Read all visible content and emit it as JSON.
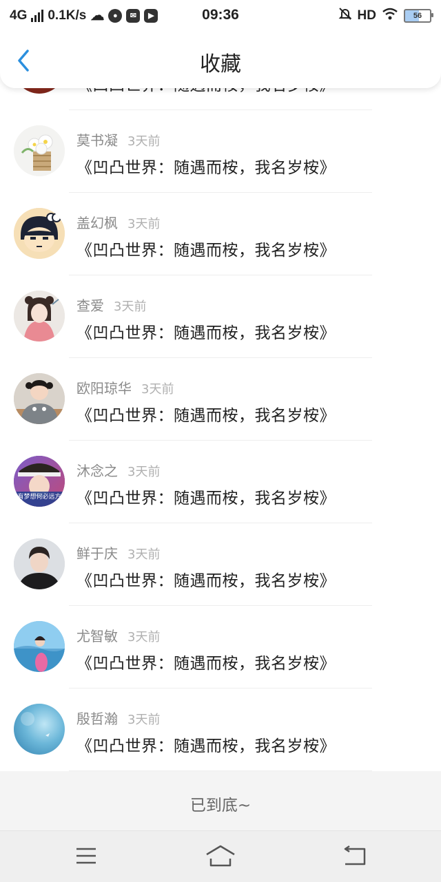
{
  "status_bar": {
    "network": "4G",
    "speed": "0.1K/s",
    "time": "09:36",
    "hd": "HD",
    "battery": "56",
    "notif_icon": "jovi-icon"
  },
  "header": {
    "title": "收藏",
    "back_icon": "back-chevron-icon",
    "accent": "#2b8fde"
  },
  "items": [
    {
      "name": "",
      "time": "",
      "content": "《凹凸世界：随遇而桉，我名岁桉》",
      "avatar": "avatar-partial"
    },
    {
      "name": "莫书凝",
      "time": "3天前",
      "content": "《凹凸世界：随遇而桉，我名岁桉》",
      "avatar": "flower-basket-avatar"
    },
    {
      "name": "盖幻枫",
      "time": "3天前",
      "content": "《凹凸世界：随遇而桉，我名岁桉》",
      "avatar": "cartoon-girl-avatar"
    },
    {
      "name": "查爱",
      "time": "3天前",
      "content": "《凹凸世界：随遇而桉，我名岁桉》",
      "avatar": "anime-girl-avatar"
    },
    {
      "name": "欧阳琼华",
      "time": "3天前",
      "content": "《凹凸世界：随遇而桉，我名岁桉》",
      "avatar": "child-shark-avatar"
    },
    {
      "name": "沐念之",
      "time": "3天前",
      "content": "《凹凸世界：随遇而桉，我名岁桉》",
      "avatar": "cap-boy-avatar",
      "avatar_caption": "有梦想何必远方"
    },
    {
      "name": "鲜于庆",
      "time": "3天前",
      "content": "《凹凸世界：随遇而桉，我名岁桉》",
      "avatar": "boy-portrait-avatar"
    },
    {
      "name": "尤智敏",
      "time": "3天前",
      "content": "《凹凸世界：随遇而桉，我名岁桉》",
      "avatar": "beach-girl-avatar"
    },
    {
      "name": "殷哲瀚",
      "time": "3天前",
      "content": "《凹凸世界：随遇而桉，我名岁桉》",
      "avatar": "sky-avatar"
    }
  ],
  "footer": {
    "end_text": "已到底~"
  },
  "nav": {
    "menu_icon": "menu-icon",
    "home_icon": "home-icon",
    "back_icon": "back-icon"
  }
}
